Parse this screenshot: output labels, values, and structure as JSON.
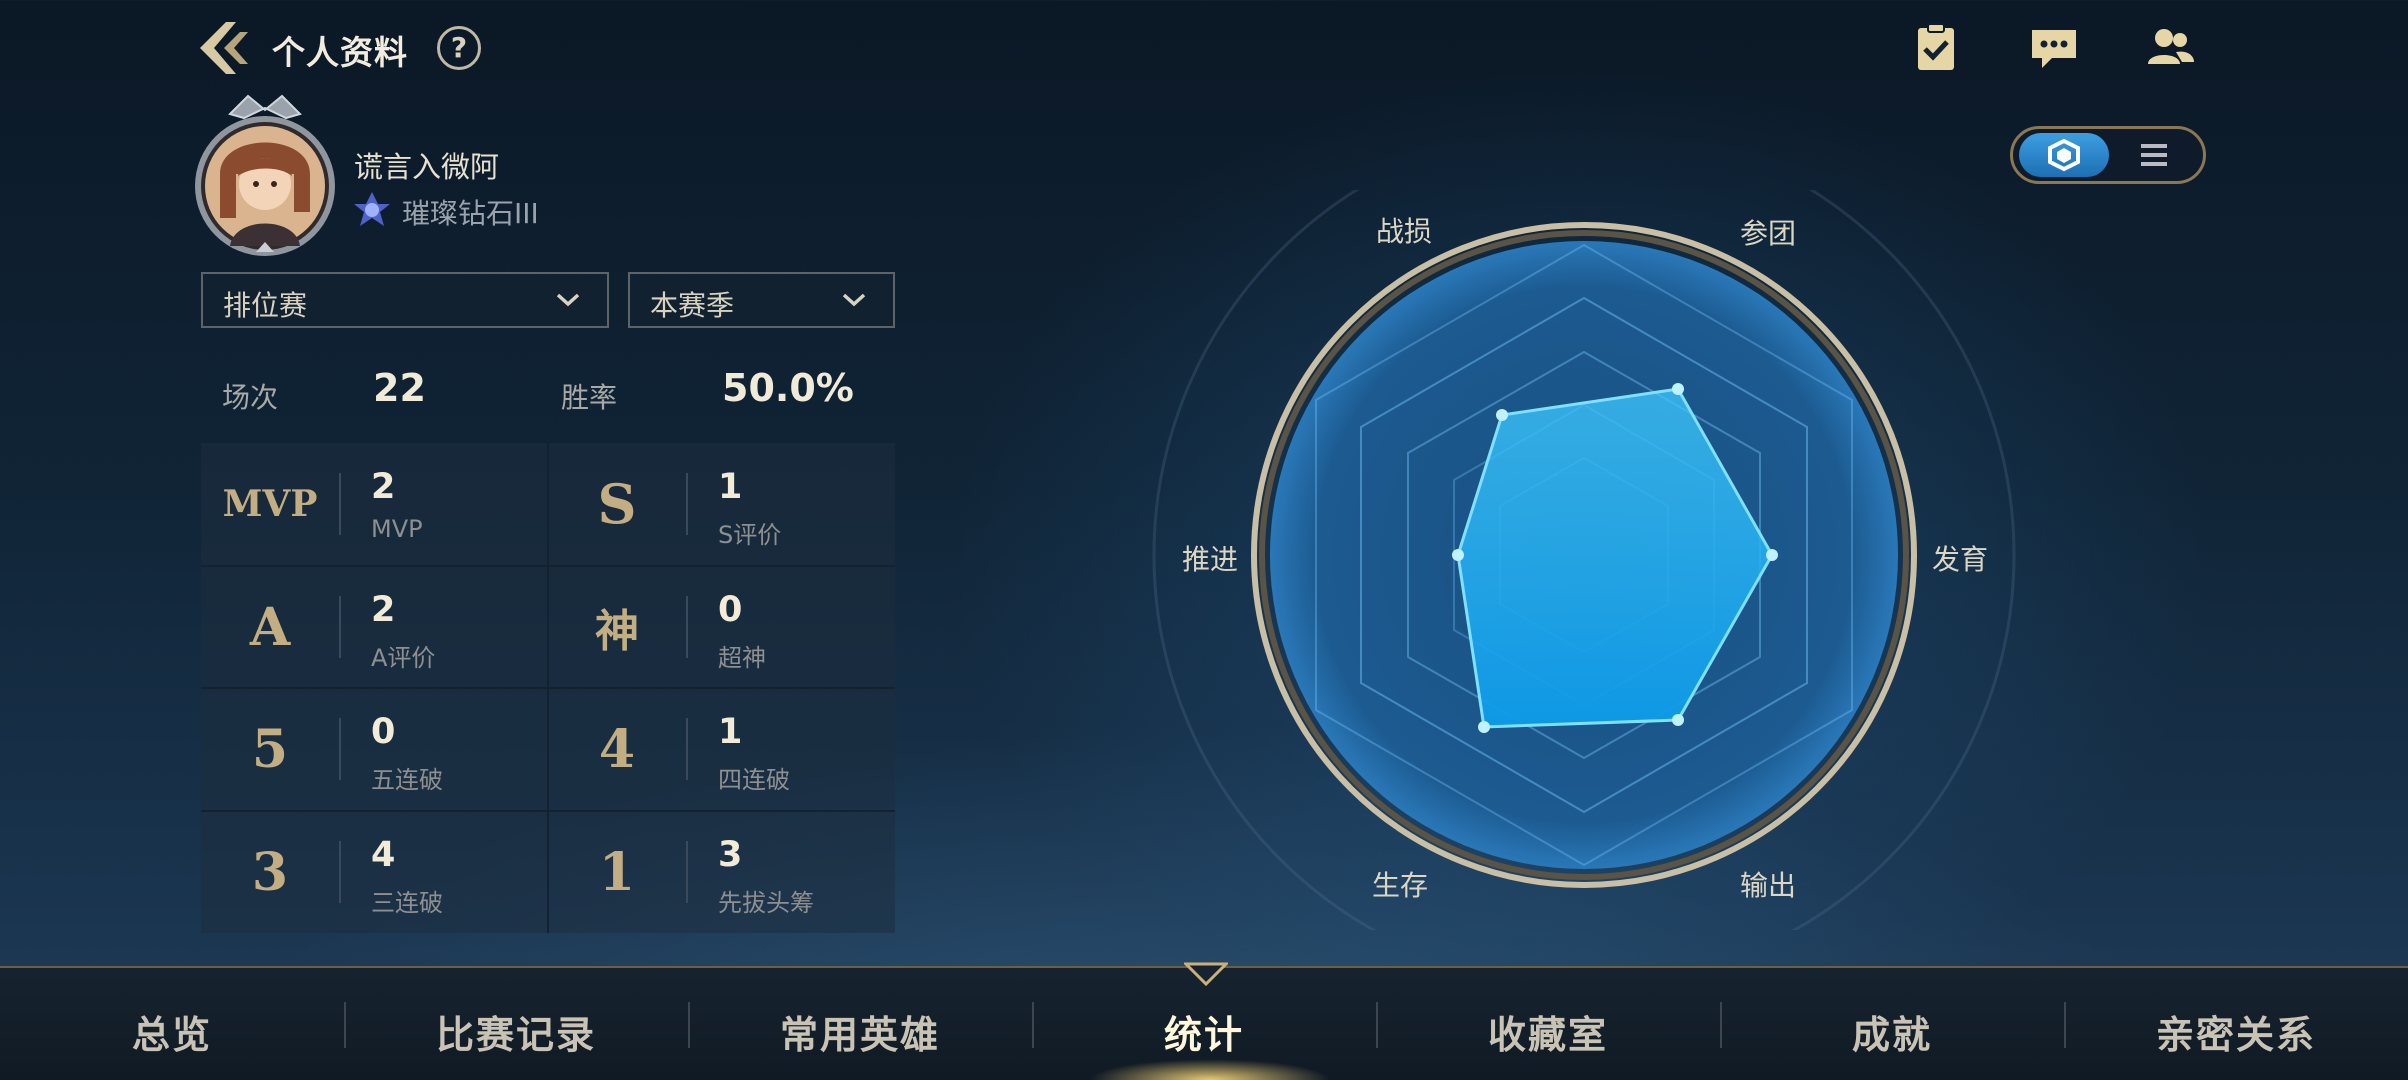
{
  "header": {
    "title": "个人资料",
    "help": "?"
  },
  "top_icons": [
    "task-icon",
    "message-icon",
    "friends-icon"
  ],
  "profile": {
    "name": "谎言入微阿",
    "rank": "璀璨钻石III"
  },
  "filters": {
    "mode": "排位赛",
    "season": "本赛季"
  },
  "summary": {
    "matches_label": "场次",
    "matches_value": "22",
    "winrate_label": "胜率",
    "winrate_value": "50.0%"
  },
  "stats": [
    {
      "glyph": "MVP",
      "value": "2",
      "label": "MVP"
    },
    {
      "glyph": "S",
      "value": "1",
      "label": "S评价"
    },
    {
      "glyph": "A",
      "value": "2",
      "label": "A评价"
    },
    {
      "glyph": "神",
      "value": "0",
      "label": "超神"
    },
    {
      "glyph": "5",
      "value": "0",
      "label": "五连破"
    },
    {
      "glyph": "4",
      "value": "1",
      "label": "四连破"
    },
    {
      "glyph": "3",
      "value": "4",
      "label": "三连破"
    },
    {
      "glyph": "1",
      "value": "3",
      "label": "先拔头筹"
    }
  ],
  "radar": {
    "labels": {
      "top_left": "战损",
      "top_right": "参团",
      "right": "发育",
      "bottom_right": "输出",
      "bottom_left": "生存",
      "left": "推进"
    }
  },
  "nav": {
    "items": [
      "总览",
      "比赛记录",
      "常用英雄",
      "统计",
      "收藏室",
      "成就",
      "亲密关系"
    ],
    "active": "统计"
  },
  "colors": {
    "accent_gold": "#c3ad82",
    "radar_blue": "#2fb6f0",
    "background": "#102436"
  }
}
